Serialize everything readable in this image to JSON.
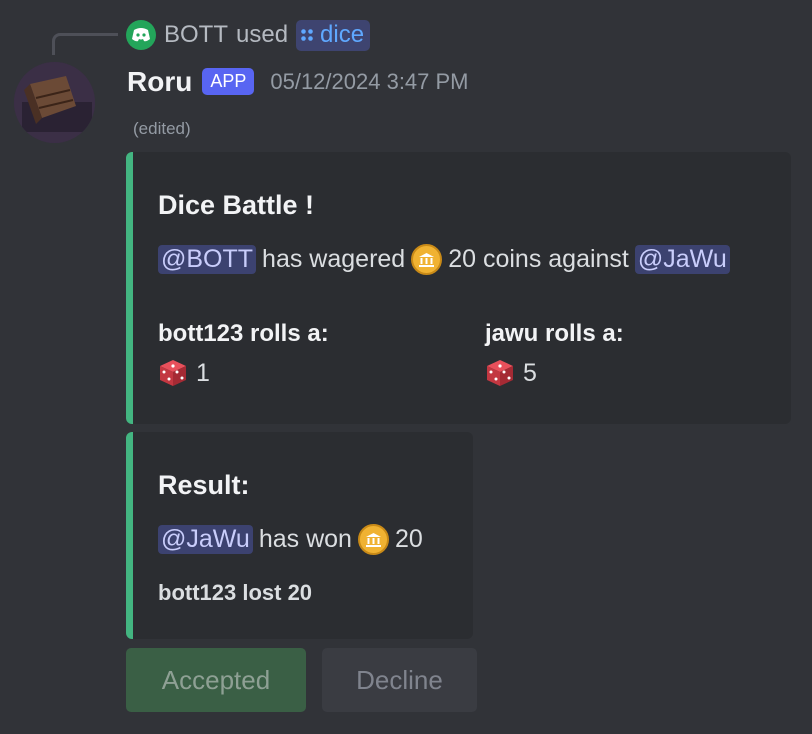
{
  "reply": {
    "user": "BOTT",
    "action": "used",
    "command": "dice"
  },
  "message": {
    "username": "Roru",
    "badge": "APP",
    "timestamp": "05/12/2024 3:47 PM",
    "edited": "(edited)"
  },
  "embed1": {
    "title": "Dice Battle !",
    "mention1": "@BOTT",
    "text1": "has wagered",
    "amount_text": "20 coins against",
    "mention2": "@JaWu",
    "fields": [
      {
        "name": "bott123 rolls a:",
        "value": "1"
      },
      {
        "name": "jawu rolls a:",
        "value": "5"
      }
    ]
  },
  "embed2": {
    "title": "Result:",
    "mention": "@JaWu",
    "text": "has won",
    "amount": "20",
    "footer": "bott123 lost 20"
  },
  "buttons": {
    "accepted": "Accepted",
    "decline": "Decline"
  },
  "colors": {
    "background": "#313338",
    "embed_bg": "#2b2d31",
    "embed_border": "#43b581",
    "brand": "#5865f2",
    "accepted_bg": "#3a5f45"
  },
  "icons": {
    "reply_app": "discord-icon",
    "command": "slash-command-icon",
    "coin": "coin-icon",
    "dice": "red-die-icon"
  }
}
